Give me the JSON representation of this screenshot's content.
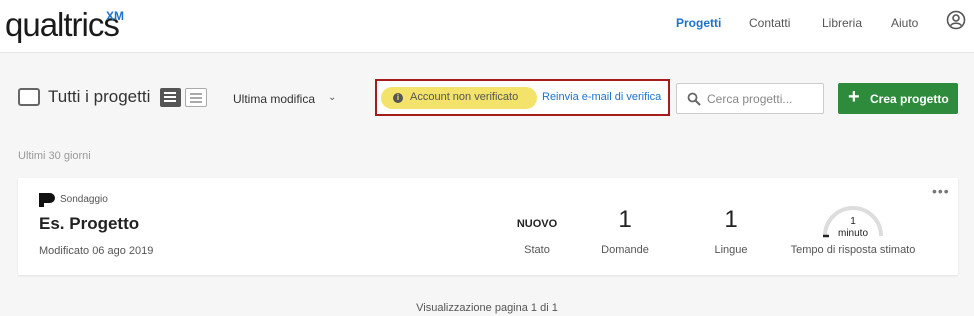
{
  "logo": {
    "text": "qualtrics",
    "superscript": "XM"
  },
  "nav": [
    {
      "label": "Progetti",
      "active": true
    },
    {
      "label": "Contatti",
      "active": false
    },
    {
      "label": "Libreria",
      "active": false
    },
    {
      "label": "Aiuto",
      "active": false
    }
  ],
  "toolbar": {
    "folder_label": "Tutti i progetti",
    "sort_label": "Ultima modifica",
    "verification_status": "Account non verificato",
    "resend_link": "Reinvia e-mail di verifica",
    "search_placeholder": "Cerca progetti...",
    "create_label": "Crea progetto"
  },
  "period_label": "Ultimi 30 giorni",
  "projects": [
    {
      "type": "Sondaggio",
      "name": "Es. Progetto",
      "modified": "Modificato 06 ago 2019",
      "status_value": "NUOVO",
      "status_label": "Stato",
      "questions_value": "1",
      "questions_label": "Domande",
      "languages_value": "1",
      "languages_label": "Lingue",
      "time_value": "1",
      "time_unit": "minuto",
      "time_label": "Tempo di risposta stimato"
    }
  ],
  "pagination": "Visualizzazione pagina 1 di 1",
  "colors": {
    "accent": "#1a73c9",
    "create": "#2f8b3c",
    "warning": "#f3e36b",
    "highlight_border": "#a61c1c"
  }
}
